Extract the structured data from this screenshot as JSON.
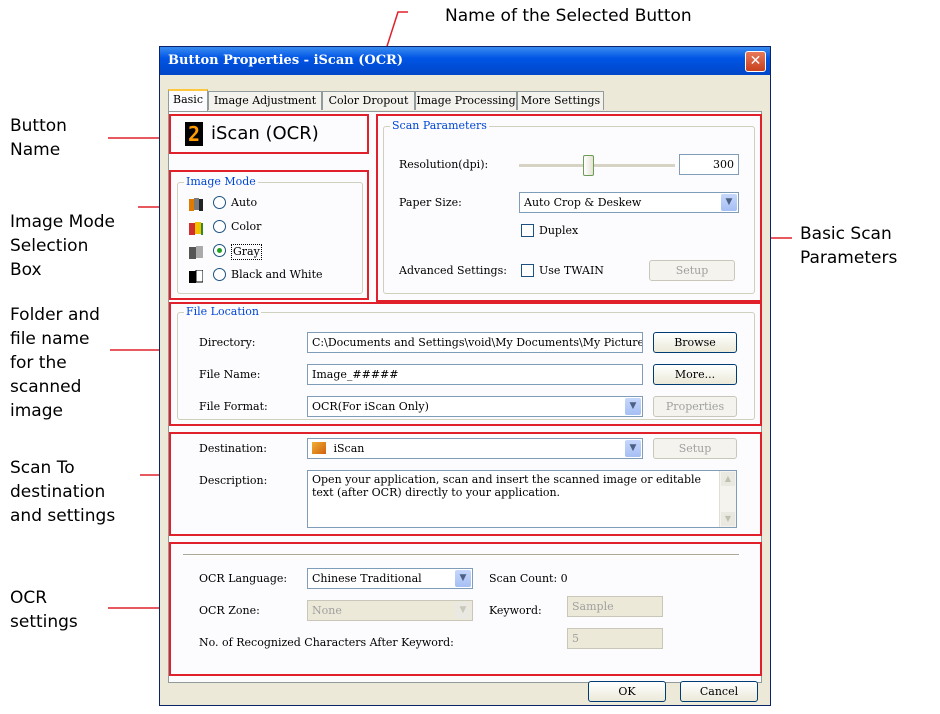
{
  "callouts": {
    "selected_button_name": "Name of the Selected Button",
    "button_name": [
      "Button",
      "Name"
    ],
    "image_mode": [
      "Image Mode",
      "Selection",
      "Box"
    ],
    "folder": [
      "Folder and",
      "file name",
      "for the",
      "scanned",
      "image"
    ],
    "scan_to": [
      "Scan To",
      "destination",
      "and settings"
    ],
    "ocr": [
      "OCR",
      "settings"
    ],
    "basic_scan": [
      "Basic Scan",
      "Parameters"
    ]
  },
  "window": {
    "title": "Button Properties - iScan (OCR)",
    "close_icon": "close-icon"
  },
  "tabs": [
    "Basic",
    "Image Adjustment",
    "Color Dropout",
    "Image Processing",
    "More Settings"
  ],
  "button_name": {
    "number": "2",
    "label": "iScan (OCR)"
  },
  "image_mode": {
    "title": "Image Mode",
    "options": [
      "Auto",
      "Color",
      "Gray",
      "Black and White"
    ],
    "selected": "Gray"
  },
  "scan_params": {
    "title": "Scan Parameters",
    "resolution_label": "Resolution(dpi):",
    "resolution_value": "300",
    "resolution_slider_fraction": 0.44,
    "paper_size_label": "Paper Size:",
    "paper_size_value": "Auto Crop & Deskew",
    "duplex_label": "Duplex",
    "advanced_label": "Advanced Settings:",
    "use_twain_label": "Use TWAIN",
    "setup_label": "Setup"
  },
  "file_location": {
    "title": "File Location",
    "directory_label": "Directory:",
    "directory_value": "C:\\Documents and Settings\\void\\My Documents\\My Pictures",
    "browse_label": "Browse",
    "file_name_label": "File Name:",
    "file_name_value": "Image_#####",
    "more_label": "More...",
    "file_format_label": "File Format:",
    "file_format_value": "OCR(For iScan Only)",
    "properties_label": "Properties"
  },
  "destination": {
    "destination_label": "Destination:",
    "destination_value": "iScan",
    "setup_label": "Setup",
    "description_label": "Description:",
    "description_value": "Open your application, scan and insert the scanned image or editable text (after OCR) directly to your application."
  },
  "ocr": {
    "language_label": "OCR Language:",
    "language_value": "Chinese Traditional",
    "scan_count_label": "Scan Count:",
    "scan_count_value": "0",
    "zone_label": "OCR Zone:",
    "zone_value": "None",
    "keyword_label": "Keyword:",
    "keyword_value": "Sample",
    "recognized_label": "No. of Recognized Characters After Keyword:",
    "recognized_value": "5"
  },
  "footer": {
    "ok_label": "OK",
    "cancel_label": "Cancel"
  },
  "colors": {
    "highlight": "#e0202a",
    "titlebar": "#0055e5",
    "group_title": "#0046d5"
  }
}
